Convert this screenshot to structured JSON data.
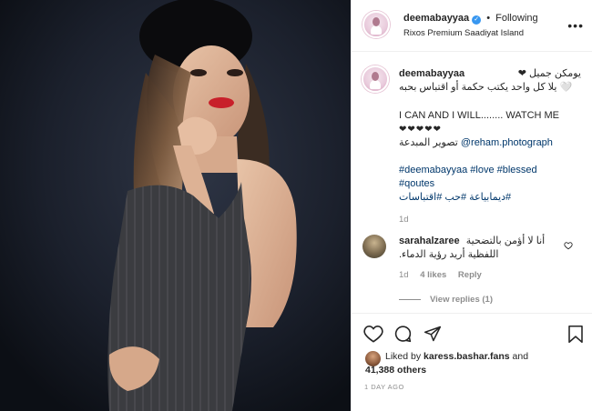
{
  "header": {
    "username": "deemabayyaa",
    "separator": "•",
    "follow_status": "Following",
    "location": "Rixos Premium Saadiyat Island",
    "more_icon": "more-horizontal-icon"
  },
  "caption": {
    "username": "deemabayyaa",
    "line1": "يومكن جميل ❤",
    "line2": "🤍 يلا كل واحد يكتب حكمة أو اقتباس بحبه",
    "english": "I CAN AND I WILL........ WATCH ME",
    "hearts": "❤❤❤❤❤",
    "photo_credit_ar": "تصوير المبدعة",
    "photo_credit_handle": "@reham.photograph",
    "hashtags_1": "#deemabayyaa #love #blessed",
    "hashtags_2": "#qoutes",
    "hashtags_ar": "#ديمابياعة #حب #اقتباسات",
    "time": "1d"
  },
  "comment": {
    "username": "sarahalzaree",
    "text_line1": "أنا لا أؤمن بالتضحية",
    "text_line2": "اللفظية أريد رؤية الدماء.",
    "time": "1d",
    "likes": "4 likes",
    "reply": "Reply",
    "view_replies": "View replies (1)"
  },
  "actions": {
    "liked_by_prefix": "Liked by",
    "liked_by_user": "karess.bashar.fans",
    "liked_by_and": "and",
    "liked_count": "41,388 others",
    "posted_ago": "1 DAY AGO"
  },
  "colors": {
    "link": "#00376b",
    "verified": "#3897f0",
    "meta": "#8e8e8e",
    "border": "#efefef"
  }
}
